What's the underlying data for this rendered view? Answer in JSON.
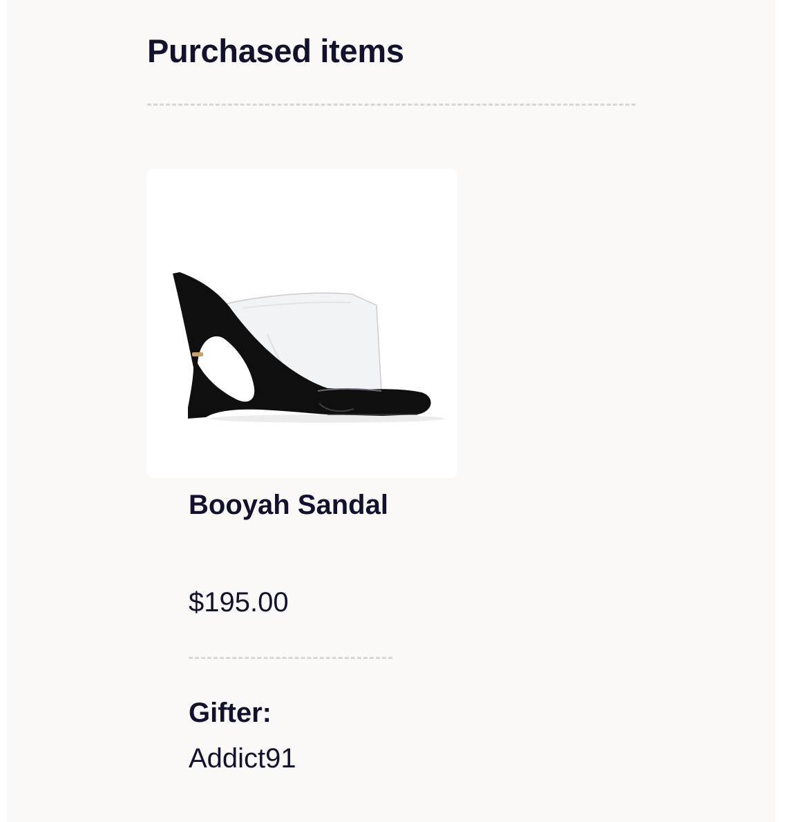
{
  "purchased": {
    "title": "Purchased items",
    "items": [
      {
        "image_icon": "wedge-mule-sandal-photo",
        "name": "Booyah Sandal",
        "price": "$195.00",
        "gifter_label": "Gifter:",
        "gifter_name": "Addict91"
      }
    ]
  },
  "colors": {
    "text": "#12122e",
    "background": "#faf9f8",
    "card": "#ffffff",
    "divider": "#d6d6d6"
  }
}
